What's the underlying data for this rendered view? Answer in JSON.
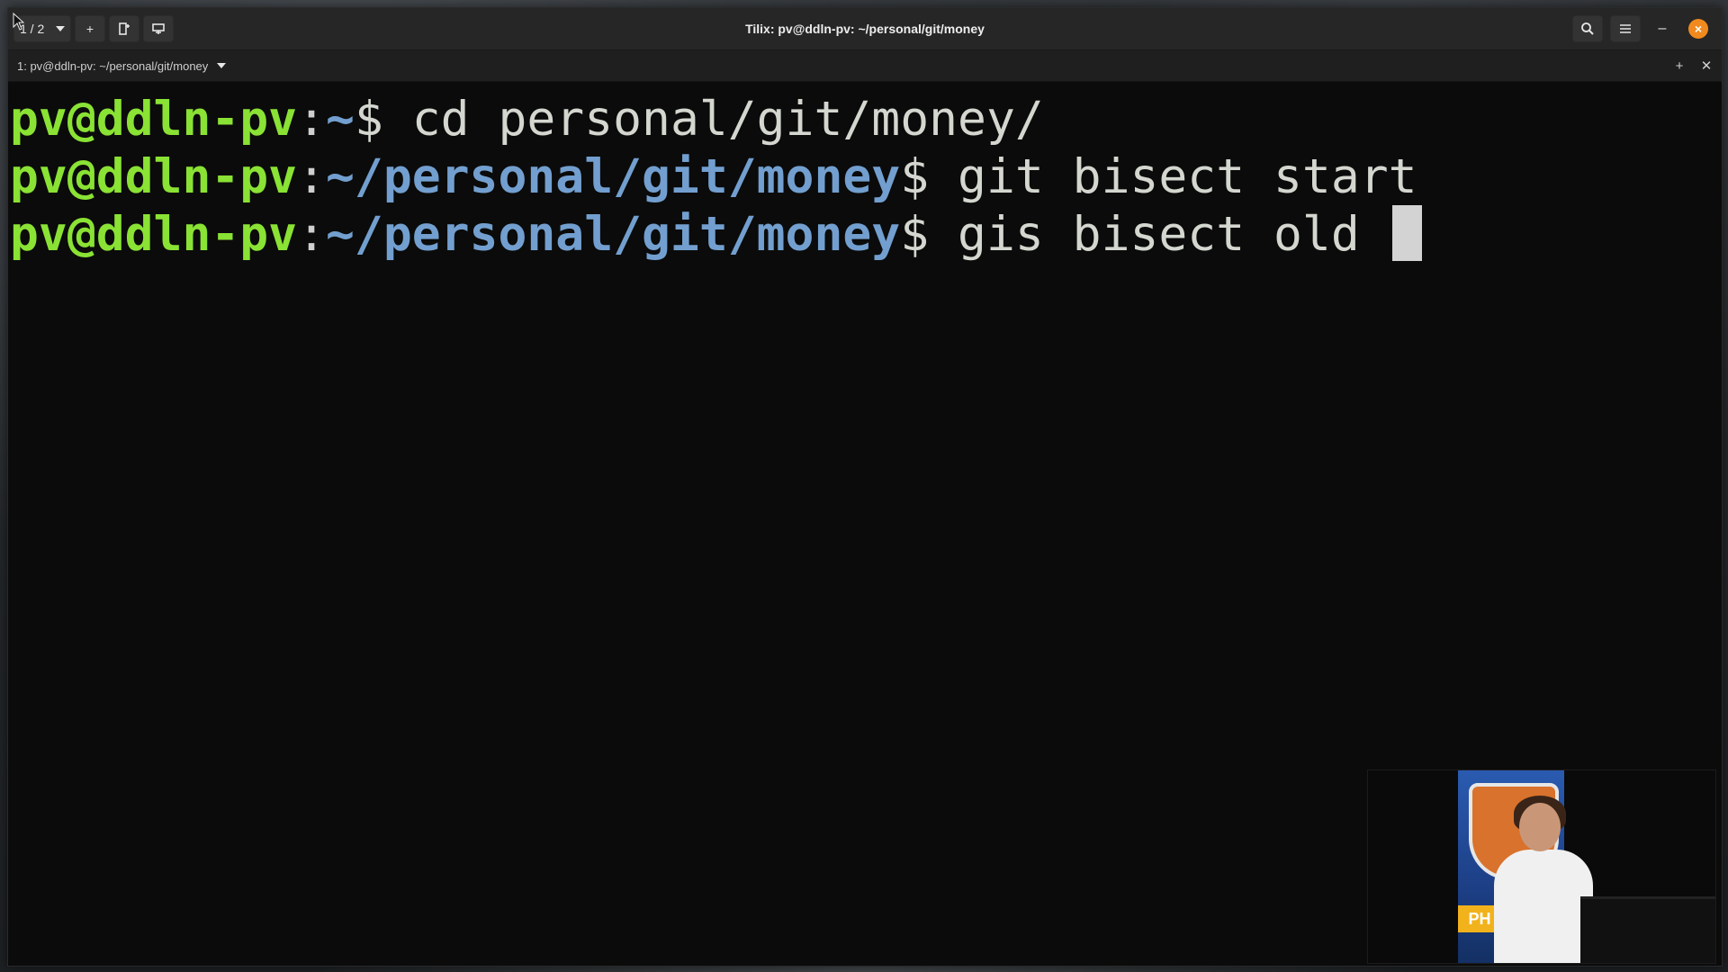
{
  "window": {
    "title": "Tilix: pv@ddln-pv: ~/personal/git/money",
    "session_indicator": "1 / 2",
    "icons": {
      "session_dropdown": "chevron-down-icon",
      "add_terminal": "plus-icon",
      "add_right": "split-right-icon",
      "add_down": "split-down-icon",
      "search": "search-icon",
      "menu": "hamburger-menu-icon",
      "minimize": "minimize-icon",
      "close": "close-icon"
    },
    "accent_color": "#f08a1e"
  },
  "tab": {
    "title": "1: pv@ddln-pv: ~/personal/git/money",
    "icons": {
      "dropdown": "chevron-down-icon",
      "maximize": "plus-icon",
      "close": "close-icon"
    }
  },
  "terminal": {
    "colors": {
      "user": "#8ae234",
      "path": "#729fcf",
      "text": "#d3d7cf",
      "background": "#0b0b0b"
    },
    "lines": [
      {
        "user": "pv@ddln-pv",
        "sep": ":",
        "path": "~",
        "prompt": "$ ",
        "command": "cd personal/git/money/"
      },
      {
        "user": "pv@ddln-pv",
        "sep": ":",
        "path": "~/personal/git/money",
        "prompt": "$ ",
        "command": "git bisect start"
      },
      {
        "user": "pv@ddln-pv",
        "sep": ":",
        "path": "~/personal/git/money",
        "prompt": "$ ",
        "command": "gis bisect old "
      }
    ]
  },
  "overlay": {
    "pip_logo_text": "PH"
  }
}
